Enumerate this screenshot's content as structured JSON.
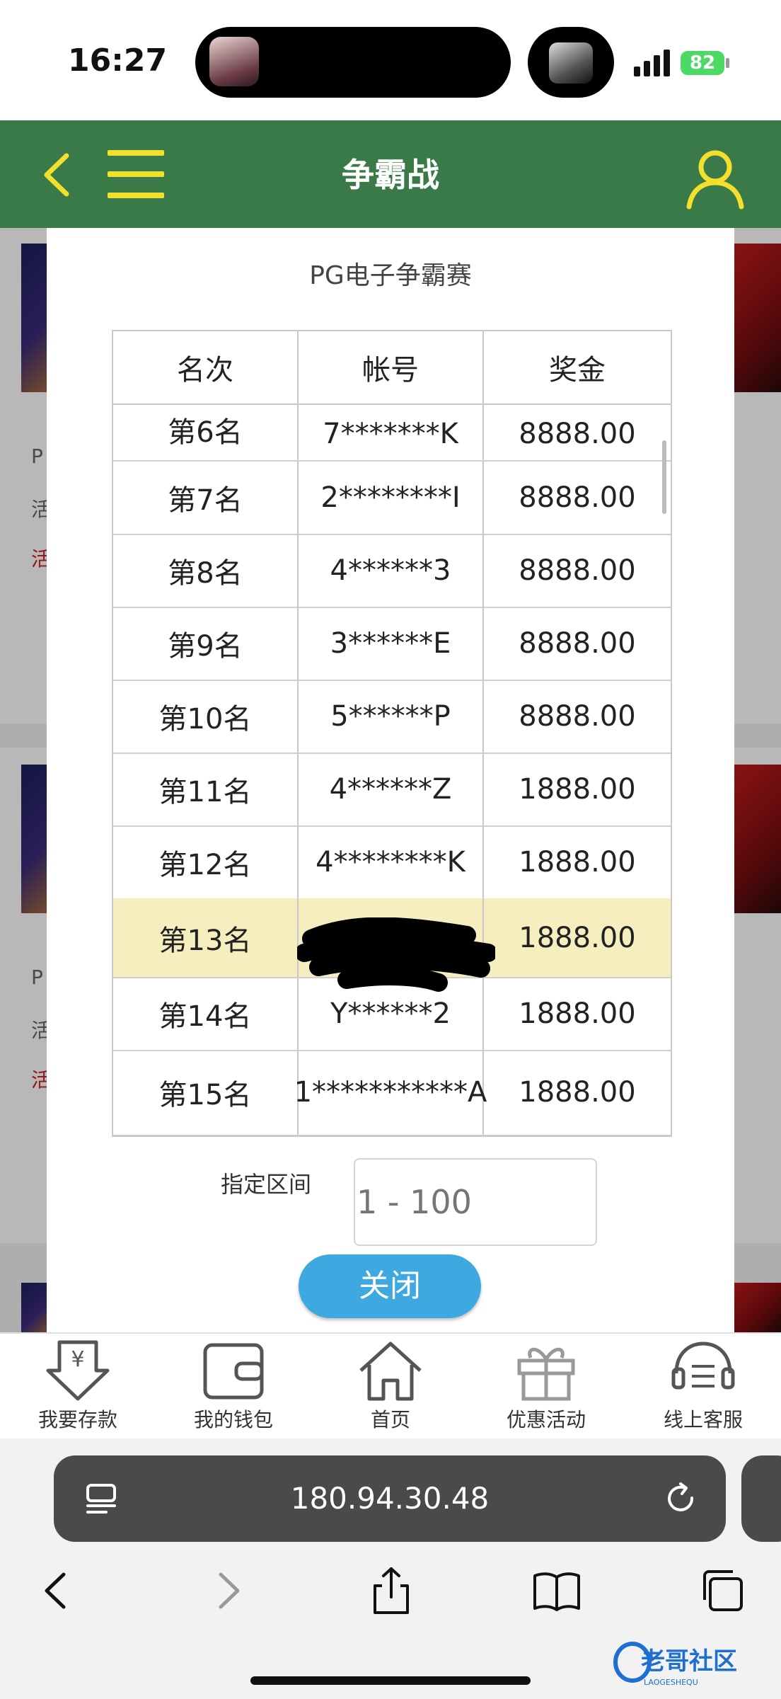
{
  "status_bar": {
    "time": "16:27",
    "battery": "82"
  },
  "header": {
    "title": "争霸战"
  },
  "background_cards": [
    {
      "title": "P",
      "line1": "活",
      "line2": "活"
    },
    {
      "title": "P",
      "line1": "活",
      "line2": "活"
    }
  ],
  "modal": {
    "title": "PG电子争霸赛",
    "columns": [
      "名次",
      "帐号",
      "奖金"
    ],
    "rows": [
      {
        "rank": "第6名",
        "account": "7*******K",
        "prize": "8888.00"
      },
      {
        "rank": "第7名",
        "account": "2********I",
        "prize": "8888.00"
      },
      {
        "rank": "第8名",
        "account": "4******3",
        "prize": "8888.00"
      },
      {
        "rank": "第9名",
        "account": "3******E",
        "prize": "8888.00"
      },
      {
        "rank": "第10名",
        "account": "5******P",
        "prize": "8888.00"
      },
      {
        "rank": "第11名",
        "account": "4******Z",
        "prize": "1888.00"
      },
      {
        "rank": "第12名",
        "account": "4********K",
        "prize": "1888.00"
      },
      {
        "rank": "第13名",
        "account": "",
        "prize": "1888.00"
      },
      {
        "rank": "第14名",
        "account": "Y******2",
        "prize": "1888.00"
      },
      {
        "rank": "第15名",
        "account": "1***********A",
        "prize": "1888.00"
      }
    ],
    "highlighted_row_index": 7,
    "range_label": "指定区间",
    "range_placeholder": "1 - 100",
    "close_label": "关闭"
  },
  "bottom_nav": [
    {
      "label": "我要存款",
      "icon": "deposit-icon"
    },
    {
      "label": "我的钱包",
      "icon": "wallet-icon"
    },
    {
      "label": "首页",
      "icon": "home-icon"
    },
    {
      "label": "优惠活动",
      "icon": "gift-icon"
    },
    {
      "label": "线上客服",
      "icon": "support-icon"
    }
  ],
  "browser": {
    "url": "180.94.30.48"
  },
  "watermark": {
    "text": "老哥社区",
    "sub": "LAOGESHEQU"
  },
  "colors": {
    "header_bg": "#3a7a48",
    "header_accent": "#f3e02c",
    "highlight_row": "#f6eebf",
    "close_button": "#3da9e0"
  }
}
